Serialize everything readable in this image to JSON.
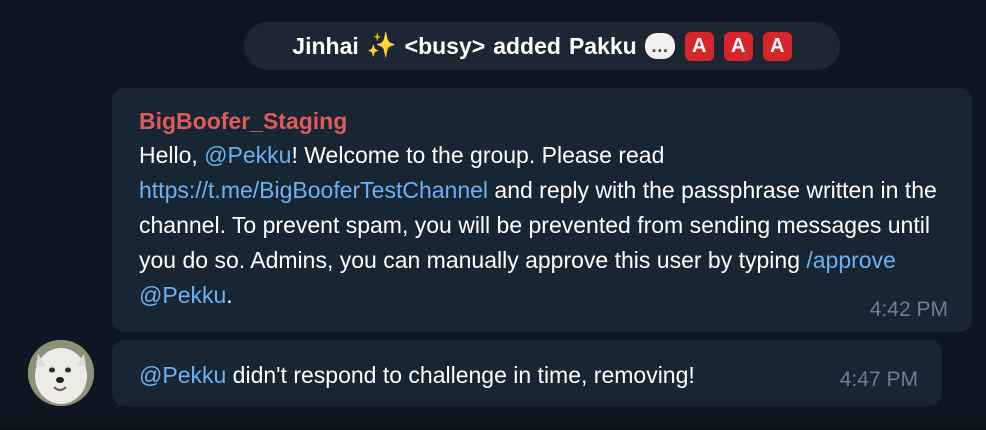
{
  "service": {
    "actor": "Jinhai",
    "sparkles": "✨",
    "tag": "<busy>",
    "action_text": "added",
    "target": "Pakku",
    "speech_glyph": "…",
    "red_letters": [
      "A",
      "A",
      "A"
    ]
  },
  "messages": [
    {
      "sender": "BigBoofer_Staging",
      "text_parts": {
        "hello": "Hello, ",
        "mention_1": "@Pekku",
        "welcome": "! Welcome to the group. Please read ",
        "link": "https://t.me/BigBooferTestChannel",
        "rest": " and reply with the passphrase written in the channel. To prevent spam, you will be prevented from sending messages until you do so. Admins, you can manually approve this user by typing ",
        "command": "/approve @Pekku",
        "end": "."
      },
      "time": "4:42 PM"
    },
    {
      "text_parts": {
        "mention": "@Pekku",
        "rest": " didn't respond to challenge in time, removing!"
      },
      "time": "4:47 PM"
    }
  ],
  "colors": {
    "background": "#0e1621",
    "bubble": "#182533",
    "sender_name": "#e05a5a",
    "link": "#6ab2f2",
    "timestamp": "#6d7f8f",
    "red_letter_badge": "#d7262b"
  },
  "icons": {
    "sparkles": "sparkles-icon",
    "speech": "speech-bubble-icon",
    "red_letter": "red-letter-a-icon",
    "avatar": "samoyed-dog-avatar"
  }
}
